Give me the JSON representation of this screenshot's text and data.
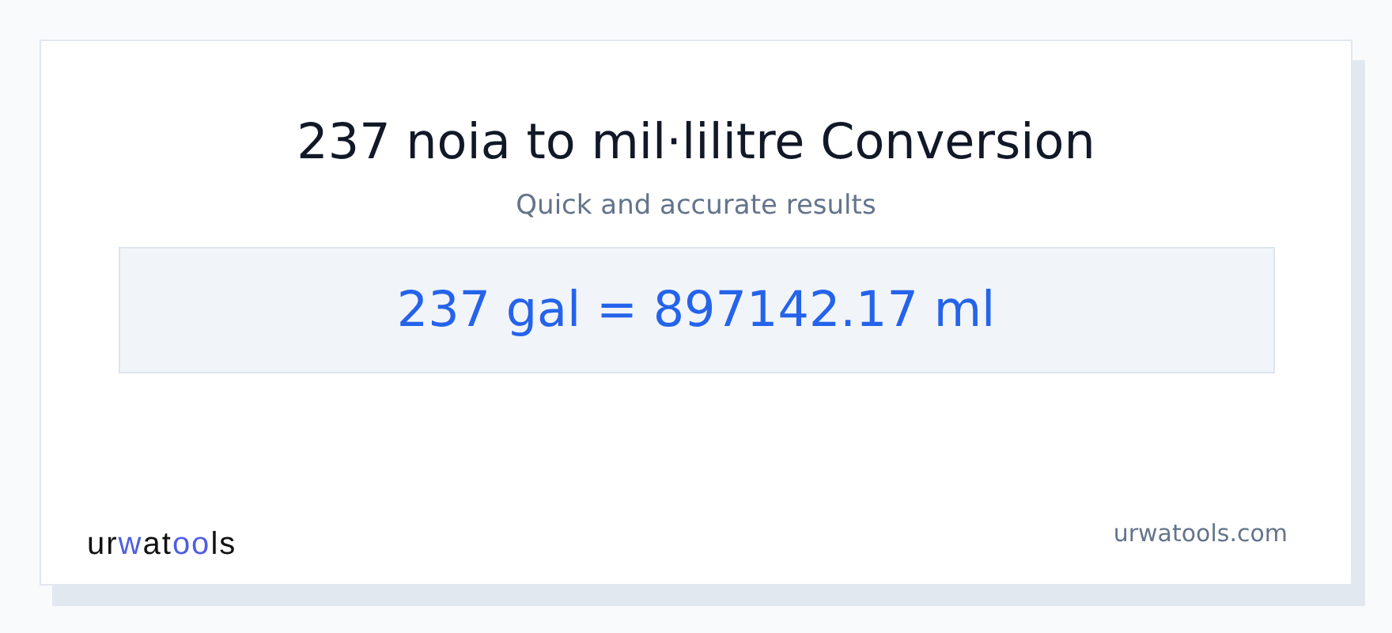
{
  "title": "237 noia to mil·lilitre Conversion",
  "subtitle": "Quick and accurate results",
  "result": "237 gal = 897142.17 ml",
  "logo": {
    "parts": [
      {
        "text": "ur",
        "color": "#111111"
      },
      {
        "text": "w",
        "color": "#4f5fe0"
      },
      {
        "text": "at",
        "color": "#111111"
      },
      {
        "text": "oo",
        "color": "#4f5fe0"
      },
      {
        "text": "ls",
        "color": "#111111"
      }
    ]
  },
  "site": "urwatools.com"
}
